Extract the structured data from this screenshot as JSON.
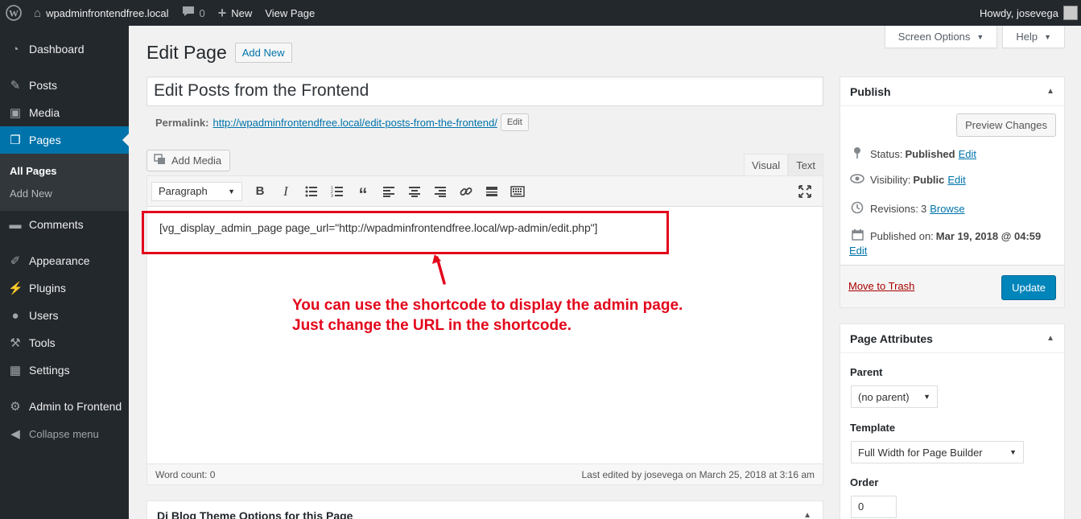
{
  "adminbar": {
    "site_name": "wpadminfrontendfree.local",
    "comments_count": "0",
    "new_label": "New",
    "view_page_label": "View Page",
    "howdy": "Howdy, josevega"
  },
  "sidebar": {
    "items": [
      {
        "label": "Dashboard",
        "icon": "dashboard-icon"
      },
      {
        "label": "Posts",
        "icon": "pin-icon"
      },
      {
        "label": "Media",
        "icon": "media-icon"
      },
      {
        "label": "Pages",
        "icon": "pages-icon"
      },
      {
        "label": "Comments",
        "icon": "comment-icon"
      },
      {
        "label": "Appearance",
        "icon": "brush-icon"
      },
      {
        "label": "Plugins",
        "icon": "plug-icon"
      },
      {
        "label": "Users",
        "icon": "user-icon"
      },
      {
        "label": "Tools",
        "icon": "wrench-icon"
      },
      {
        "label": "Settings",
        "icon": "sliders-icon"
      },
      {
        "label": "Admin to Frontend",
        "icon": "gear-icon"
      },
      {
        "label": "Collapse menu",
        "icon": "collapse-icon"
      }
    ],
    "submenu": [
      "All Pages",
      "Add New"
    ]
  },
  "screen_options": {
    "screen_options_label": "Screen Options",
    "help_label": "Help"
  },
  "page": {
    "heading": "Edit Page",
    "add_new_label": "Add New",
    "title_value": "Edit Posts from the Frontend",
    "permalink_label": "Permalink:",
    "permalink_url": "http://wpadminfrontendfree.local/edit-posts-from-the-frontend/",
    "permalink_edit": "Edit"
  },
  "editor": {
    "add_media_label": "Add Media",
    "tab_visual": "Visual",
    "tab_text": "Text",
    "format_select": "Paragraph",
    "content": "[vg_display_admin_page page_url=\"http://wpadminfrontendfree.local/wp-admin/edit.php\"]",
    "word_count": "Word count: 0",
    "last_edited": "Last edited by josevega on March 25, 2018 at 3:16 am"
  },
  "annotation": {
    "line1": "You can use the shortcode to display the admin page.",
    "line2": "Just change the URL in the shortcode.",
    "color": "#e3061b"
  },
  "metabox_bottom": {
    "title": "Di Blog Theme Options for this Page"
  },
  "publish": {
    "title": "Publish",
    "preview_label": "Preview Changes",
    "status_label": "Status:",
    "status_value": "Published",
    "visibility_label": "Visibility:",
    "visibility_value": "Public",
    "revisions_label": "Revisions:",
    "revisions_value": "3",
    "browse_label": "Browse",
    "published_on_label": "Published on:",
    "published_on_value": "Mar 19, 2018 @ 04:59",
    "edit_label": "Edit",
    "trash_label": "Move to Trash",
    "update_label": "Update"
  },
  "attributes": {
    "title": "Page Attributes",
    "parent_label": "Parent",
    "parent_value": "(no parent)",
    "template_label": "Template",
    "template_value": "Full Width for Page Builder",
    "order_label": "Order",
    "order_value": "0"
  }
}
